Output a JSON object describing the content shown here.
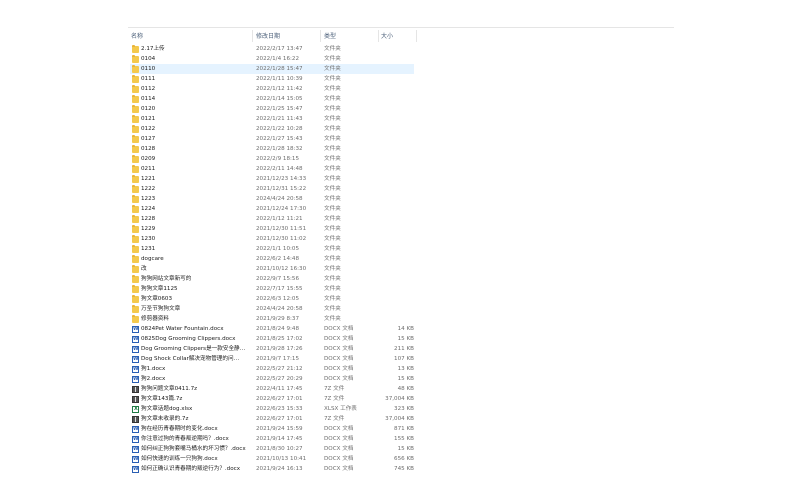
{
  "columns": {
    "name": "名称",
    "date": "修改日期",
    "type": "类型",
    "size": "大小"
  },
  "icons": {
    "sort": "sort-up-icon",
    "folder": "folder-icon",
    "docx": "word-document-icon",
    "xlsx": "excel-document-icon",
    "7z": "archive-icon"
  },
  "colors": {
    "selection": "#e5f3ff",
    "folder": "#f4c94d",
    "header_text": "#4c607a"
  },
  "files": [
    {
      "name": "2.17上传",
      "date": "2022/2/17 13:47",
      "type": "文件夹",
      "size": "",
      "kind": "folder"
    },
    {
      "name": "0104",
      "date": "2022/1/4 16:22",
      "type": "文件夹",
      "size": "",
      "kind": "folder"
    },
    {
      "name": "0110",
      "date": "2022/1/28 15:47",
      "type": "文件夹",
      "size": "",
      "kind": "folder",
      "selected": true
    },
    {
      "name": "0111",
      "date": "2022/1/11 10:39",
      "type": "文件夹",
      "size": "",
      "kind": "folder"
    },
    {
      "name": "0112",
      "date": "2022/1/12 11:42",
      "type": "文件夹",
      "size": "",
      "kind": "folder"
    },
    {
      "name": "0114",
      "date": "2022/1/14 15:05",
      "type": "文件夹",
      "size": "",
      "kind": "folder"
    },
    {
      "name": "0120",
      "date": "2022/1/25 15:47",
      "type": "文件夹",
      "size": "",
      "kind": "folder"
    },
    {
      "name": "0121",
      "date": "2022/1/21 11:43",
      "type": "文件夹",
      "size": "",
      "kind": "folder"
    },
    {
      "name": "0122",
      "date": "2022/1/22 10:28",
      "type": "文件夹",
      "size": "",
      "kind": "folder"
    },
    {
      "name": "0127",
      "date": "2022/1/27 15:43",
      "type": "文件夹",
      "size": "",
      "kind": "folder"
    },
    {
      "name": "0128",
      "date": "2022/1/28 18:32",
      "type": "文件夹",
      "size": "",
      "kind": "folder"
    },
    {
      "name": "0209",
      "date": "2022/2/9 18:15",
      "type": "文件夹",
      "size": "",
      "kind": "folder"
    },
    {
      "name": "0211",
      "date": "2022/2/11 14:48",
      "type": "文件夹",
      "size": "",
      "kind": "folder"
    },
    {
      "name": "1221",
      "date": "2021/12/23 14:33",
      "type": "文件夹",
      "size": "",
      "kind": "folder"
    },
    {
      "name": "1222",
      "date": "2021/12/31 15:22",
      "type": "文件夹",
      "size": "",
      "kind": "folder"
    },
    {
      "name": "1223",
      "date": "2024/4/24 20:58",
      "type": "文件夹",
      "size": "",
      "kind": "folder"
    },
    {
      "name": "1224",
      "date": "2021/12/24 17:30",
      "type": "文件夹",
      "size": "",
      "kind": "folder"
    },
    {
      "name": "1228",
      "date": "2022/1/12 11:21",
      "type": "文件夹",
      "size": "",
      "kind": "folder"
    },
    {
      "name": "1229",
      "date": "2021/12/30 11:51",
      "type": "文件夹",
      "size": "",
      "kind": "folder"
    },
    {
      "name": "1230",
      "date": "2021/12/30 11:02",
      "type": "文件夹",
      "size": "",
      "kind": "folder"
    },
    {
      "name": "1231",
      "date": "2022/1/1 10:05",
      "type": "文件夹",
      "size": "",
      "kind": "folder"
    },
    {
      "name": "dogcare",
      "date": "2022/6/2 14:48",
      "type": "文件夹",
      "size": "",
      "kind": "folder"
    },
    {
      "name": "改",
      "date": "2021/10/12 16:30",
      "type": "文件夹",
      "size": "",
      "kind": "folder"
    },
    {
      "name": "狗狗网站文章新写的",
      "date": "2022/9/7 15:56",
      "type": "文件夹",
      "size": "",
      "kind": "folder"
    },
    {
      "name": "狗狗文章1125",
      "date": "2022/7/17 15:55",
      "type": "文件夹",
      "size": "",
      "kind": "folder"
    },
    {
      "name": "狗文章0603",
      "date": "2022/6/3 12:05",
      "type": "文件夹",
      "size": "",
      "kind": "folder"
    },
    {
      "name": "万圣节狗狗文章",
      "date": "2024/4/24 20:58",
      "type": "文件夹",
      "size": "",
      "kind": "folder"
    },
    {
      "name": "修剪器资料",
      "date": "2021/9/29 8:37",
      "type": "文件夹",
      "size": "",
      "kind": "folder"
    },
    {
      "name": "0824Pet Water Fountain.docx",
      "date": "2021/8/24 9:48",
      "type": "DOCX 文档",
      "size": "14 KB",
      "kind": "docx"
    },
    {
      "name": "0825Dog Grooming Clippers.docx",
      "date": "2021/8/25 17:02",
      "type": "DOCX 文档",
      "size": "15 KB",
      "kind": "docx"
    },
    {
      "name": "Dog Grooming Clippers是一款安全静…",
      "date": "2021/9/28 17:26",
      "type": "DOCX 文档",
      "size": "211 KB",
      "kind": "docx"
    },
    {
      "name": "Dog Shock Collar解决宠物管理的问…",
      "date": "2021/9/7 17:15",
      "type": "DOCX 文档",
      "size": "107 KB",
      "kind": "docx"
    },
    {
      "name": "狗1.docx",
      "date": "2022/5/27 21:12",
      "type": "DOCX 文档",
      "size": "13 KB",
      "kind": "docx"
    },
    {
      "name": "狗2.docx",
      "date": "2022/5/27 20:29",
      "type": "DOCX 文档",
      "size": "15 KB",
      "kind": "docx"
    },
    {
      "name": "狗狗问题文章0411.7z",
      "date": "2022/4/11 17:45",
      "type": "7Z 文件",
      "size": "48 KB",
      "kind": "7z"
    },
    {
      "name": "狗文章143篇.7z",
      "date": "2022/6/27 17:01",
      "type": "7Z 文件",
      "size": "37,004 KB",
      "kind": "7z"
    },
    {
      "name": "狗文章话题dog.xlsx",
      "date": "2022/6/23 15:33",
      "type": "XLSX 工作表",
      "size": "323 KB",
      "kind": "xlsx"
    },
    {
      "name": "狗文章未收录的.7z",
      "date": "2022/6/27 17:01",
      "type": "7Z 文件",
      "size": "37,004 KB",
      "kind": "7z"
    },
    {
      "name": "狗在经历青春期时的变化.docx",
      "date": "2021/9/24 15:59",
      "type": "DOCX 文档",
      "size": "871 KB",
      "kind": "docx"
    },
    {
      "name": "你注意过狗的青春叛逆期吗？.docx",
      "date": "2021/9/14 17:45",
      "type": "DOCX 文档",
      "size": "155 KB",
      "kind": "docx"
    },
    {
      "name": "如何纠正狗狗套嘴马桶水的坏习惯？.docx",
      "date": "2021/8/30 10:27",
      "type": "DOCX 文档",
      "size": "15 KB",
      "kind": "docx"
    },
    {
      "name": "如何快速的训练一只狗狗.docx",
      "date": "2021/10/13 10:41",
      "type": "DOCX 文档",
      "size": "656 KB",
      "kind": "docx"
    },
    {
      "name": "如何正确认识青春期的叛逆行为？.docx",
      "date": "2021/9/24 16:13",
      "type": "DOCX 文档",
      "size": "745 KB",
      "kind": "docx"
    }
  ]
}
